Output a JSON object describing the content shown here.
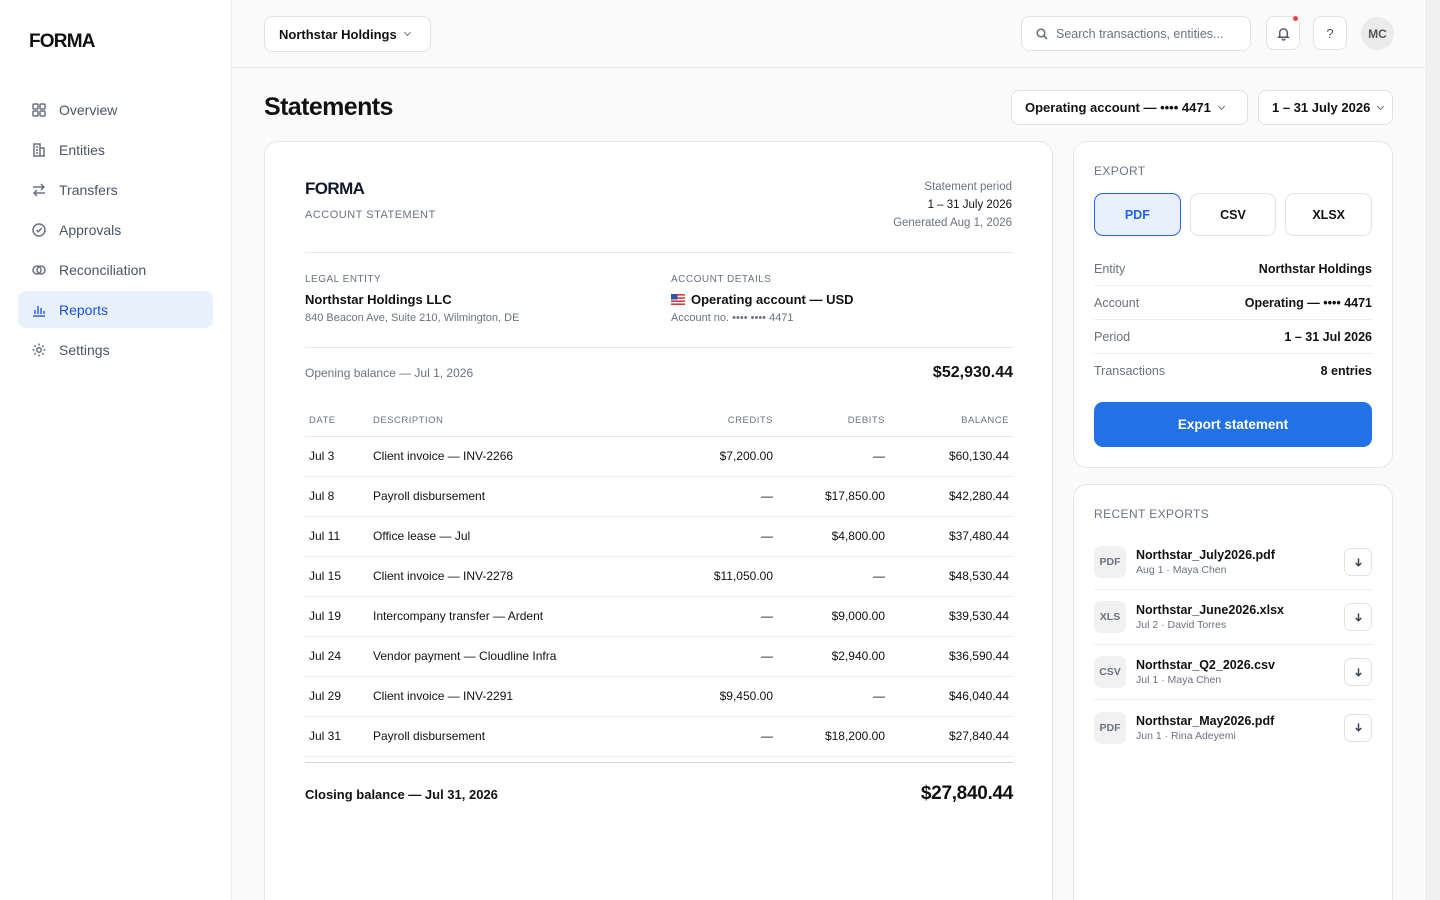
{
  "app": {
    "logo": "FORMA"
  },
  "sidebar": {
    "items": [
      {
        "label": "Overview",
        "icon": "grid-icon",
        "active": false
      },
      {
        "label": "Entities",
        "icon": "building-icon",
        "active": false
      },
      {
        "label": "Transfers",
        "icon": "arrows-icon",
        "active": false
      },
      {
        "label": "Approvals",
        "icon": "check-circle-icon",
        "active": false
      },
      {
        "label": "Reconciliation",
        "icon": "overlap-circles-icon",
        "active": false
      },
      {
        "label": "Reports",
        "icon": "bar-chart-icon",
        "active": true
      },
      {
        "label": "Settings",
        "icon": "gear-icon",
        "active": false
      }
    ]
  },
  "topbar": {
    "entity": "Northstar Holdings",
    "search_placeholder": "Search transactions, entities...",
    "help": "?",
    "avatar": "MC"
  },
  "page": {
    "title": "Statements",
    "account_select": "Operating account — •••• 4471",
    "period_select": "1 – 31 July 2026"
  },
  "statement": {
    "logo": "FORMA",
    "subtitle": "ACCOUNT STATEMENT",
    "period_label": "Statement period",
    "period_value": "1 – 31 July 2026",
    "generated": "Generated Aug 1, 2026",
    "legal_entity_label": "LEGAL ENTITY",
    "legal_entity_name": "Northstar Holdings LLC",
    "legal_entity_address": "840 Beacon Ave, Suite 210, Wilmington, DE",
    "account_details_label": "ACCOUNT DETAILS",
    "account_name": "Operating account — USD",
    "account_no": "Account no. •••• •••• 4471",
    "opening_label": "Opening balance — Jul 1, 2026",
    "opening_value": "$52,930.44",
    "columns": [
      "DATE",
      "DESCRIPTION",
      "CREDITS",
      "DEBITS",
      "BALANCE"
    ],
    "rows": [
      {
        "date": "Jul 3",
        "description": "Client invoice — INV-2266",
        "credit": "$7,200.00",
        "debit": "—",
        "balance": "$60,130.44"
      },
      {
        "date": "Jul 8",
        "description": "Payroll disbursement",
        "credit": "—",
        "debit": "$17,850.00",
        "balance": "$42,280.44"
      },
      {
        "date": "Jul 11",
        "description": "Office lease — Jul",
        "credit": "—",
        "debit": "$4,800.00",
        "balance": "$37,480.44"
      },
      {
        "date": "Jul 15",
        "description": "Client invoice — INV-2278",
        "credit": "$11,050.00",
        "debit": "—",
        "balance": "$48,530.44"
      },
      {
        "date": "Jul 19",
        "description": "Intercompany transfer — Ardent",
        "credit": "—",
        "debit": "$9,000.00",
        "balance": "$39,530.44"
      },
      {
        "date": "Jul 24",
        "description": "Vendor payment — Cloudline Infra",
        "credit": "—",
        "debit": "$2,940.00",
        "balance": "$36,590.44"
      },
      {
        "date": "Jul 29",
        "description": "Client invoice — INV-2291",
        "credit": "$9,450.00",
        "debit": "—",
        "balance": "$46,040.44"
      },
      {
        "date": "Jul 31",
        "description": "Payroll disbursement",
        "credit": "—",
        "debit": "$18,200.00",
        "balance": "$27,840.44"
      }
    ],
    "closing_label": "Closing balance — Jul 31, 2026",
    "closing_value": "$27,840.44"
  },
  "export": {
    "label": "EXPORT",
    "formats": [
      "PDF",
      "CSV",
      "XLSX"
    ],
    "selected_format": "PDF",
    "meta": [
      {
        "key": "Entity",
        "value": "Northstar Holdings"
      },
      {
        "key": "Account",
        "value": "Operating — •••• 4471"
      },
      {
        "key": "Period",
        "value": "1 – 31 Jul 2026"
      },
      {
        "key": "Transactions",
        "value": "8 entries"
      }
    ],
    "button": "Export statement"
  },
  "recent": {
    "label": "RECENT EXPORTS",
    "items": [
      {
        "type": "PDF",
        "name": "Northstar_July2026.pdf",
        "meta": "Aug 1 · Maya Chen"
      },
      {
        "type": "XLS",
        "name": "Northstar_June2026.xlsx",
        "meta": "Jul 2 · David Torres"
      },
      {
        "type": "CSV",
        "name": "Northstar_Q2_2026.csv",
        "meta": "Jul 1 · Maya Chen"
      },
      {
        "type": "PDF",
        "name": "Northstar_May2026.pdf",
        "meta": "Jun 1 · Rina Adeyemi"
      }
    ]
  },
  "colors": {
    "accent": "#2272e6",
    "active_bg": "#e8f0fb",
    "notification": "#ef4444"
  }
}
